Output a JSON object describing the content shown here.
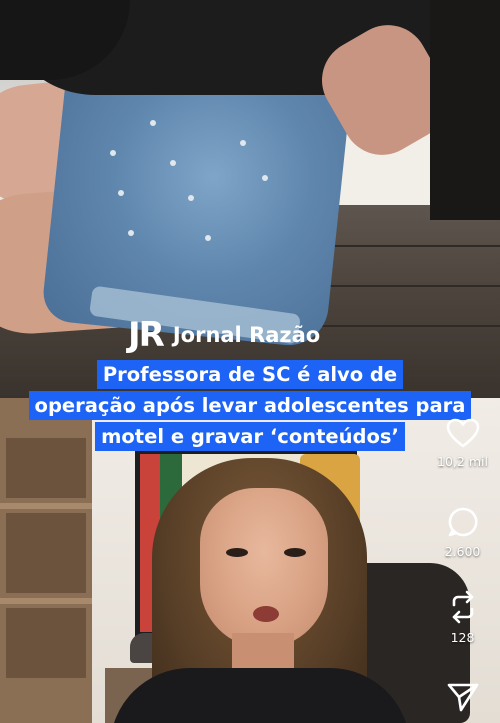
{
  "post": {
    "brand_mark": "JR",
    "brand_name": "Jornal Razão",
    "headline_lines": [
      "Professora de SC é alvo de",
      "operação após levar adolescentes para",
      "motel e gravar ‘conteúdos’"
    ]
  },
  "actions": {
    "like": {
      "icon": "heart-icon",
      "count": "10,2 mil"
    },
    "comment": {
      "icon": "comment-icon",
      "count": "2.600"
    },
    "repost": {
      "icon": "repost-icon",
      "count": "128"
    },
    "share": {
      "icon": "send-icon"
    }
  },
  "colors": {
    "headline_bg": "#1d63f5",
    "text": "#ffffff"
  }
}
